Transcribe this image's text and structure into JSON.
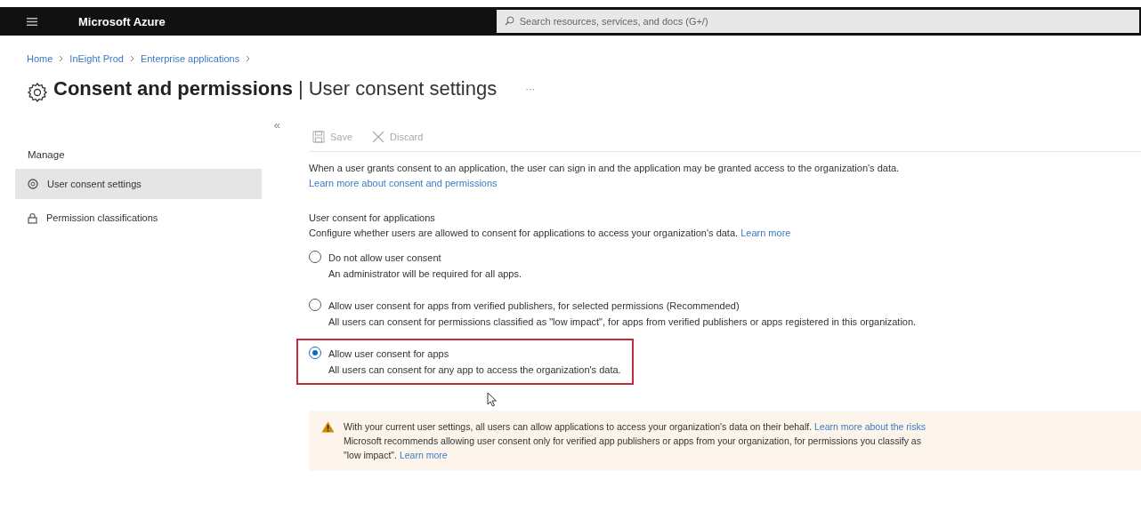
{
  "topbar": {
    "brand": "Microsoft Azure",
    "search": {
      "placeholder": "Search resources, services, and docs (G+/)"
    }
  },
  "breadcrumb": [
    "Home",
    "InEight Prod",
    "Enterprise applications"
  ],
  "page": {
    "title": "Consent and permissions",
    "separator": "|",
    "subtitle": "User consent settings",
    "more": "···"
  },
  "sidebar": {
    "collapse": "«",
    "section": "Manage",
    "items": [
      {
        "label": "User consent settings",
        "kind": "gear",
        "selected": true
      },
      {
        "label": "Permission classifications",
        "kind": "lock",
        "selected": false
      }
    ]
  },
  "toolbar": [
    {
      "label": "Save",
      "kind": "save",
      "disabled": true
    },
    {
      "label": "Discard",
      "kind": "close",
      "disabled": true
    }
  ],
  "intro": {
    "text": "When a user grants consent to an application, the user can sign in and the application may be granted access to the organization's data.",
    "link": "Learn more about consent and permissions"
  },
  "consent": {
    "heading": "User consent for applications",
    "description": "Configure whether users are allowed to consent for applications to access your organization's data.",
    "link": "Learn more",
    "options": [
      {
        "label": "Do not allow user consent",
        "description": "An administrator will be required for all apps.",
        "selected": false
      },
      {
        "label": "Allow user consent for apps from verified publishers, for selected permissions (Recommended)",
        "description": "All users can consent for permissions classified as \"low impact\", for apps from verified publishers or apps registered in this organization.",
        "selected": false
      },
      {
        "label": "Allow user consent for apps",
        "description": "All users can consent for any app to access the organization's data.",
        "selected": true
      }
    ]
  },
  "warning": {
    "line1": "With your current user settings, all users can allow applications to access your organization's data on their behalf.",
    "link1": "Learn more about the risks",
    "line2": "Microsoft recommends allowing user consent only for verified app publishers or apps from your organization, for permissions you classify as",
    "line3": "\"low impact\".",
    "link2": "Learn more"
  }
}
